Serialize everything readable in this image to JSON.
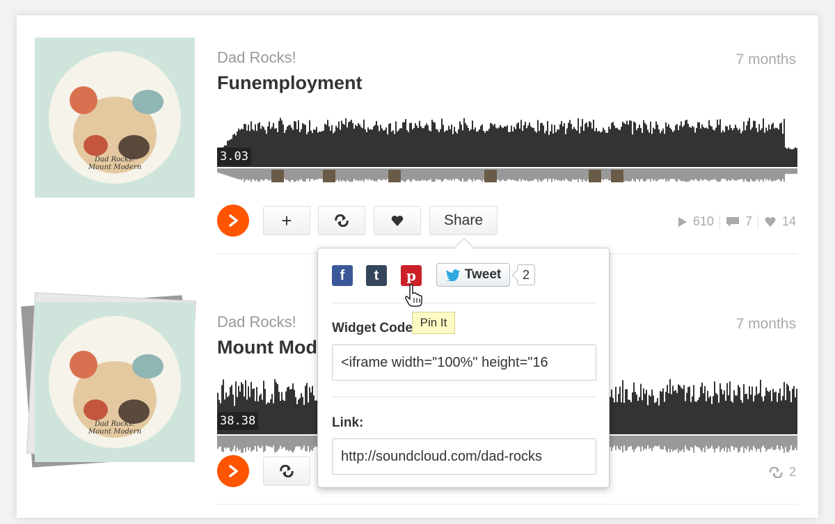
{
  "tracks": [
    {
      "user": "Dad Rocks!",
      "title": "Funemployment",
      "age": "7 months",
      "time": "3.03",
      "artwork_signature": "Dad Rocks!\nMount Modern",
      "actions": {
        "add": "+",
        "share": "Share"
      },
      "stats": {
        "plays": "610",
        "comments": "7",
        "likes": "14"
      }
    },
    {
      "user": "Dad Rocks!",
      "title": "Mount Modern",
      "age": "7 months",
      "time": "38.38",
      "artwork_signature": "Dad Rocks!\nMount Modern",
      "stats": {
        "reposts": "2"
      }
    }
  ],
  "share_popover": {
    "social": [
      {
        "name": "facebook",
        "glyph": "f",
        "color": "#3b5998"
      },
      {
        "name": "tumblr",
        "glyph": "t",
        "color": "#35465c"
      },
      {
        "name": "pinterest",
        "glyph": "p",
        "color": "#cb2027"
      }
    ],
    "tweet_label": "Tweet",
    "tweet_count": "2",
    "widget_label": "Widget Code:",
    "widget_value": "<iframe width=\"100%\" height=\"16",
    "link_label": "Link:",
    "link_value": "http://soundcloud.com/dad-rocks"
  },
  "tooltip": "Pin It",
  "colors": {
    "accent": "#ff5500",
    "waveform": "#333333",
    "waveform_reflection": "#999999"
  }
}
